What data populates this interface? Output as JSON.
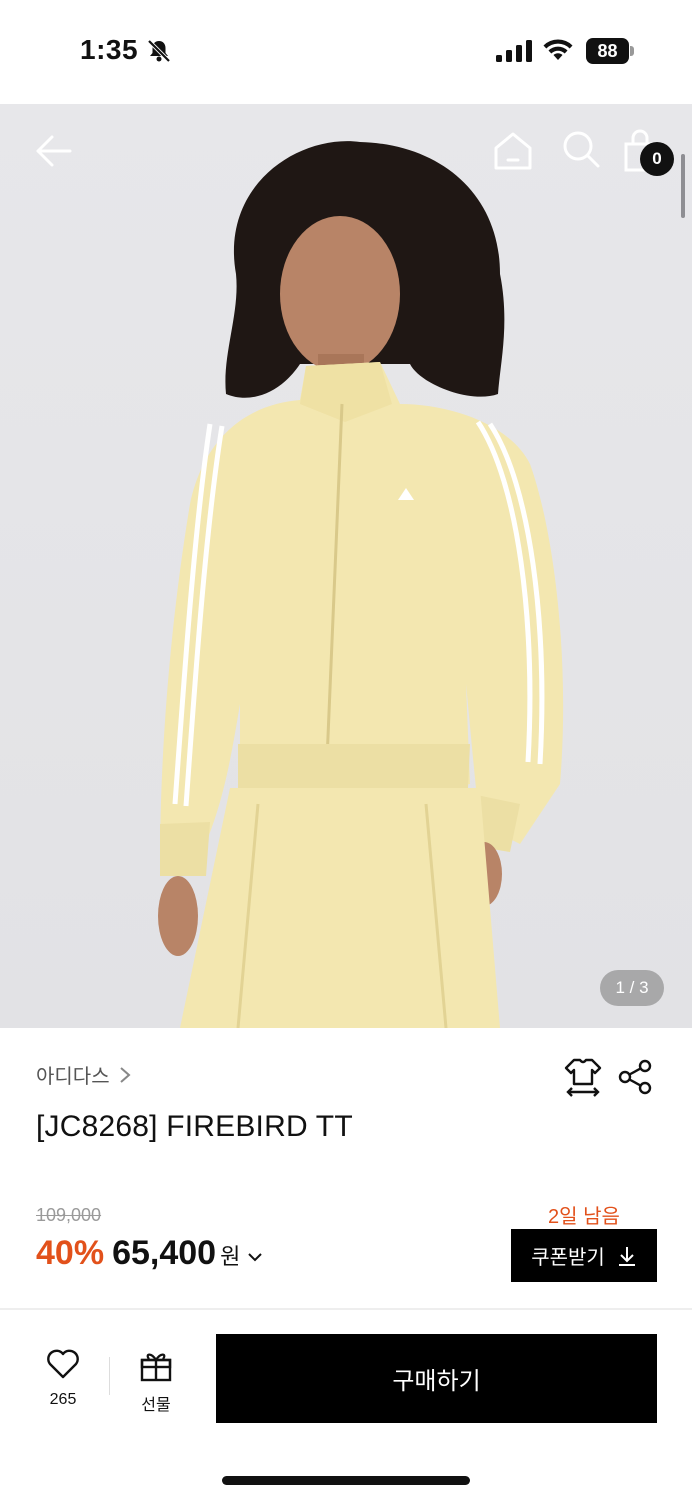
{
  "status_bar": {
    "time": "1:35",
    "battery": "88"
  },
  "gallery": {
    "counter": "1 / 3",
    "cart_count": "0"
  },
  "product": {
    "brand": "아디다스",
    "title": "[JC8268] FIREBIRD TT",
    "original_price": "109,000",
    "discount": "40%",
    "sale_price": "65,400",
    "currency": "원"
  },
  "coupon": {
    "deadline": "2일 남음",
    "button_label": "쿠폰받기"
  },
  "bottom_bar": {
    "wish_count": "265",
    "gift_label": "선물",
    "buy_label": "구매하기"
  },
  "colors": {
    "accent": "#e2511b",
    "primary": "#000000",
    "jacket": "#f3e7b0"
  },
  "icons": [
    "back-arrow-icon",
    "home-icon",
    "search-icon",
    "shopping-bag-icon",
    "fit-icon",
    "share-icon",
    "heart-icon",
    "gift-icon",
    "download-icon",
    "chevron-right-icon",
    "chevron-down-icon"
  ]
}
